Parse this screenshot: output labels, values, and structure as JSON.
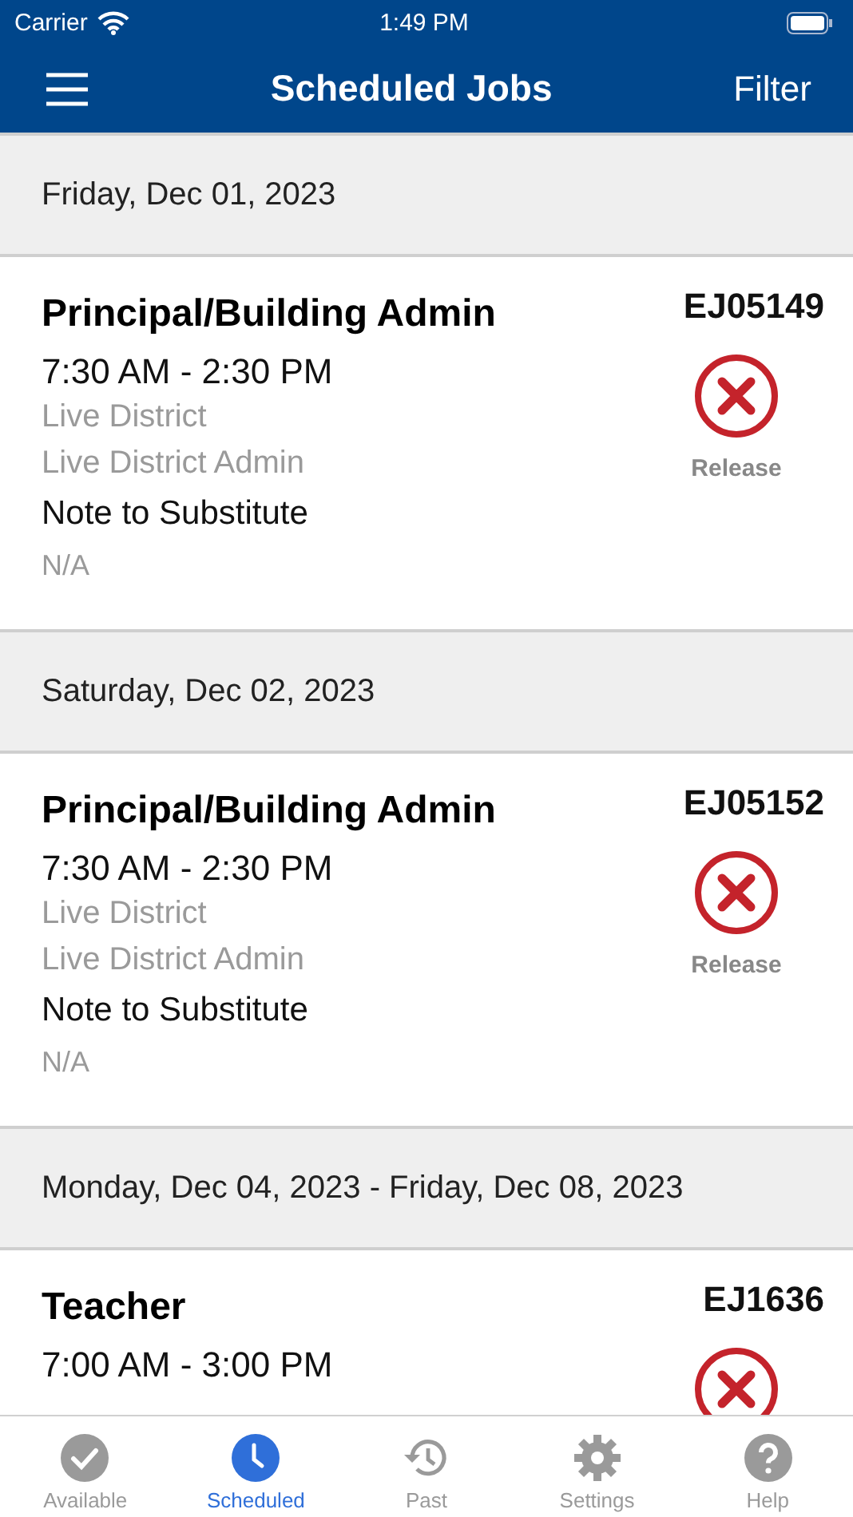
{
  "status_bar": {
    "carrier": "Carrier",
    "time": "1:49 PM"
  },
  "nav_bar": {
    "title": "Scheduled Jobs",
    "action": "Filter"
  },
  "groups": [
    {
      "date": "Friday, Dec 01, 2023",
      "jobs": [
        {
          "title": "Principal/Building Admin",
          "job_id": "EJ05149",
          "time": "7:30 AM - 2:30 PM",
          "location": "Live District",
          "contact": "Live District Admin",
          "note_label": "Note to Substitute",
          "note": "N/A",
          "action": "Release"
        }
      ]
    },
    {
      "date": "Saturday, Dec 02, 2023",
      "jobs": [
        {
          "title": "Principal/Building Admin",
          "job_id": "EJ05152",
          "time": "7:30 AM - 2:30 PM",
          "location": "Live District",
          "contact": "Live District Admin",
          "note_label": "Note to Substitute",
          "note": "N/A",
          "action": "Release"
        }
      ]
    },
    {
      "date": "Monday, Dec 04, 2023 - Friday, Dec 08, 2023",
      "jobs": [
        {
          "title": "Teacher",
          "job_id": "EJ1636",
          "time": "7:00 AM - 3:00 PM"
        }
      ]
    }
  ],
  "tab_bar": [
    {
      "label": "Available",
      "selected": false
    },
    {
      "label": "Scheduled",
      "selected": true
    },
    {
      "label": "Past",
      "selected": false
    },
    {
      "label": "Settings",
      "selected": false
    },
    {
      "label": "Help",
      "selected": false
    }
  ]
}
